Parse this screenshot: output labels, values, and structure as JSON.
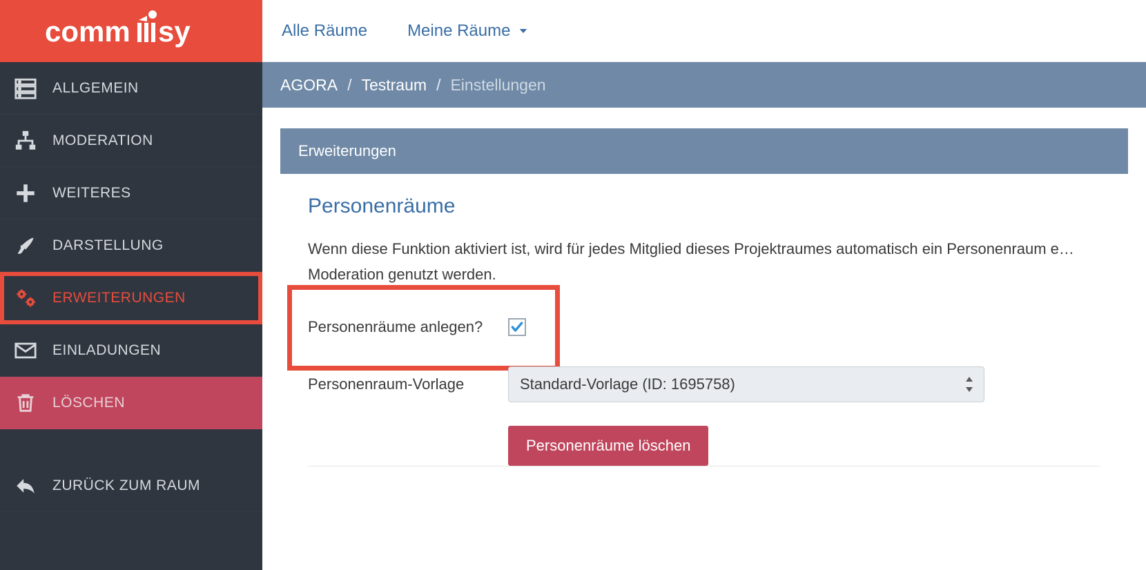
{
  "sidebar": {
    "logo_text": "commsy",
    "items": [
      {
        "label": "ALLGEMEIN",
        "icon": "server-icon"
      },
      {
        "label": "MODERATION",
        "icon": "sitemap-icon"
      },
      {
        "label": "WEITERES",
        "icon": "plus-icon"
      },
      {
        "label": "DARSTELLUNG",
        "icon": "brush-icon"
      },
      {
        "label": "ERWEITERUNGEN",
        "icon": "cogs-icon",
        "active": true
      },
      {
        "label": "EINLADUNGEN",
        "icon": "envelope-icon"
      },
      {
        "label": "LÖSCHEN",
        "icon": "trash-icon",
        "danger": true
      }
    ],
    "back_label": "ZURÜCK ZUM RAUM"
  },
  "topnav": {
    "all_rooms": "Alle Räume",
    "my_rooms": "Meine Räume"
  },
  "breadcrumb": {
    "root": "AGORA",
    "room": "Testraum",
    "page": "Einstellungen"
  },
  "panel": {
    "header": "Erweiterungen",
    "section_title": "Personenräume",
    "section_desc": "Wenn diese Funktion aktiviert ist, wird für jedes Mitglied dieses Projektraumes automatisch ein Personenraum e… Moderation genutzt werden.",
    "create_label": "Personenräume anlegen?",
    "create_checked": true,
    "template_label": "Personenraum-Vorlage",
    "template_value": "Standard-Vorlage (ID: 1695758)",
    "delete_button": "Personenräume löschen"
  }
}
